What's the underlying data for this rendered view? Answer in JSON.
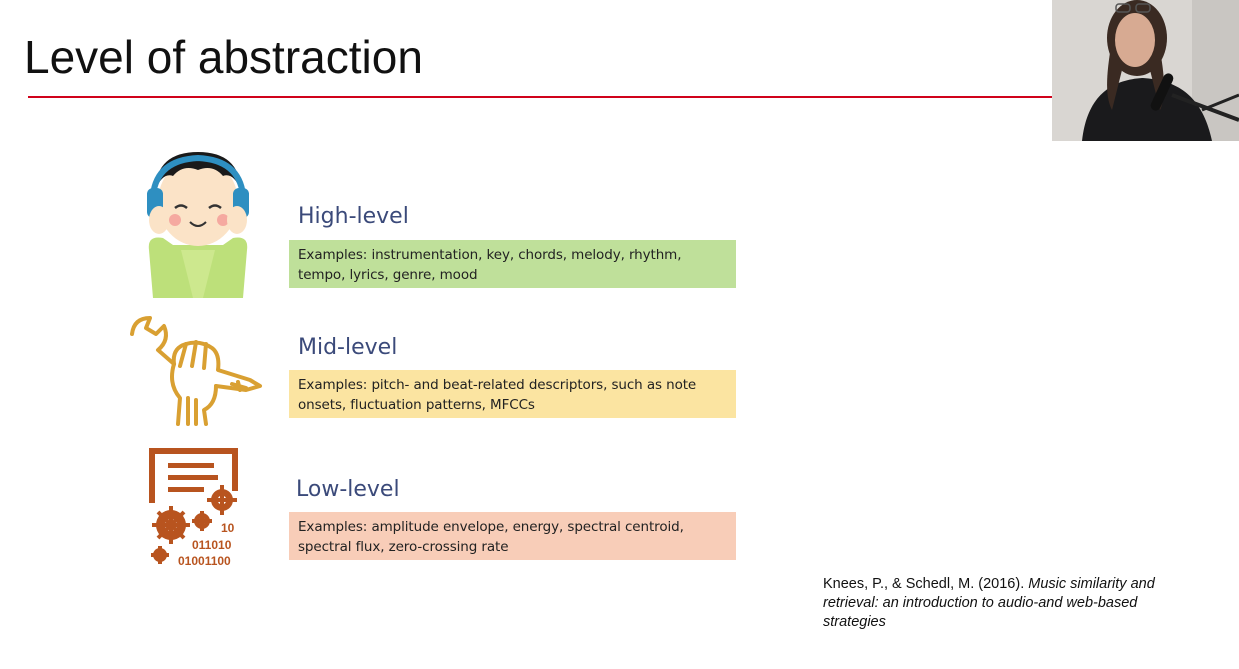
{
  "slide": {
    "title": "Level of abstraction"
  },
  "levels": [
    {
      "icon": "child-with-headphones-icon",
      "title": "High-level",
      "examples": "Examples: instrumentation, key, chords, melody, rhythm, tempo, lyrics, genre, mood",
      "color": "#bfe09a"
    },
    {
      "icon": "hand-holding-wrench-icon",
      "title": "Mid-level",
      "examples": "Examples: pitch- and beat-related descriptors, such as note onsets, fluctuation patterns, MFCCs",
      "color": "#fbe4a1"
    },
    {
      "icon": "document-gears-binary-icon",
      "title": "Low-level",
      "examples": "Examples: amplitude envelope, energy, spectral centroid, spectral flux, zero-crossing rate",
      "color": "#f8cdb8"
    }
  ],
  "binary": [
    "10",
    "011010",
    "01001100"
  ],
  "citation": {
    "authors": "Knees, P., & Schedl, M. (2016).",
    "title_italic": "Music similarity and retrieval: an introduction to audio-and web-based strategies"
  },
  "colors": {
    "accent_rule": "#d0021b",
    "heading": "#3b4a7a",
    "icon_orange": "#b8541f",
    "icon_gold": "#d9a032"
  }
}
